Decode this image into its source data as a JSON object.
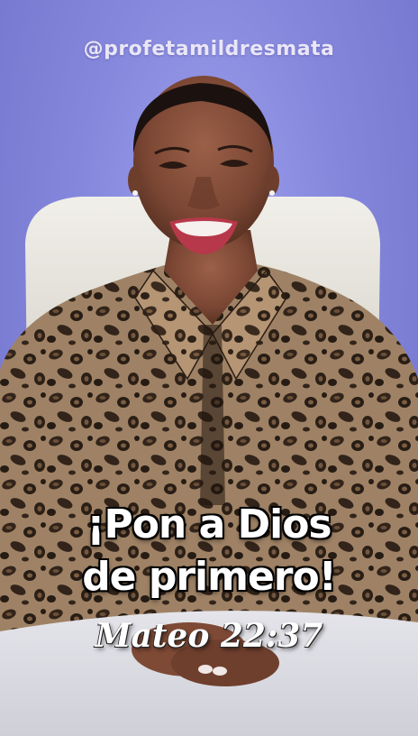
{
  "overlay": {
    "handle": "@profetamildresmata",
    "headline_line1": "¡Pon a Dios",
    "headline_line2": "de primero!",
    "verse": "Mateo 22:37"
  },
  "colors": {
    "background": "#8587dc",
    "caption_text": "#ffffff",
    "handle_text": "#e9e6f7"
  }
}
